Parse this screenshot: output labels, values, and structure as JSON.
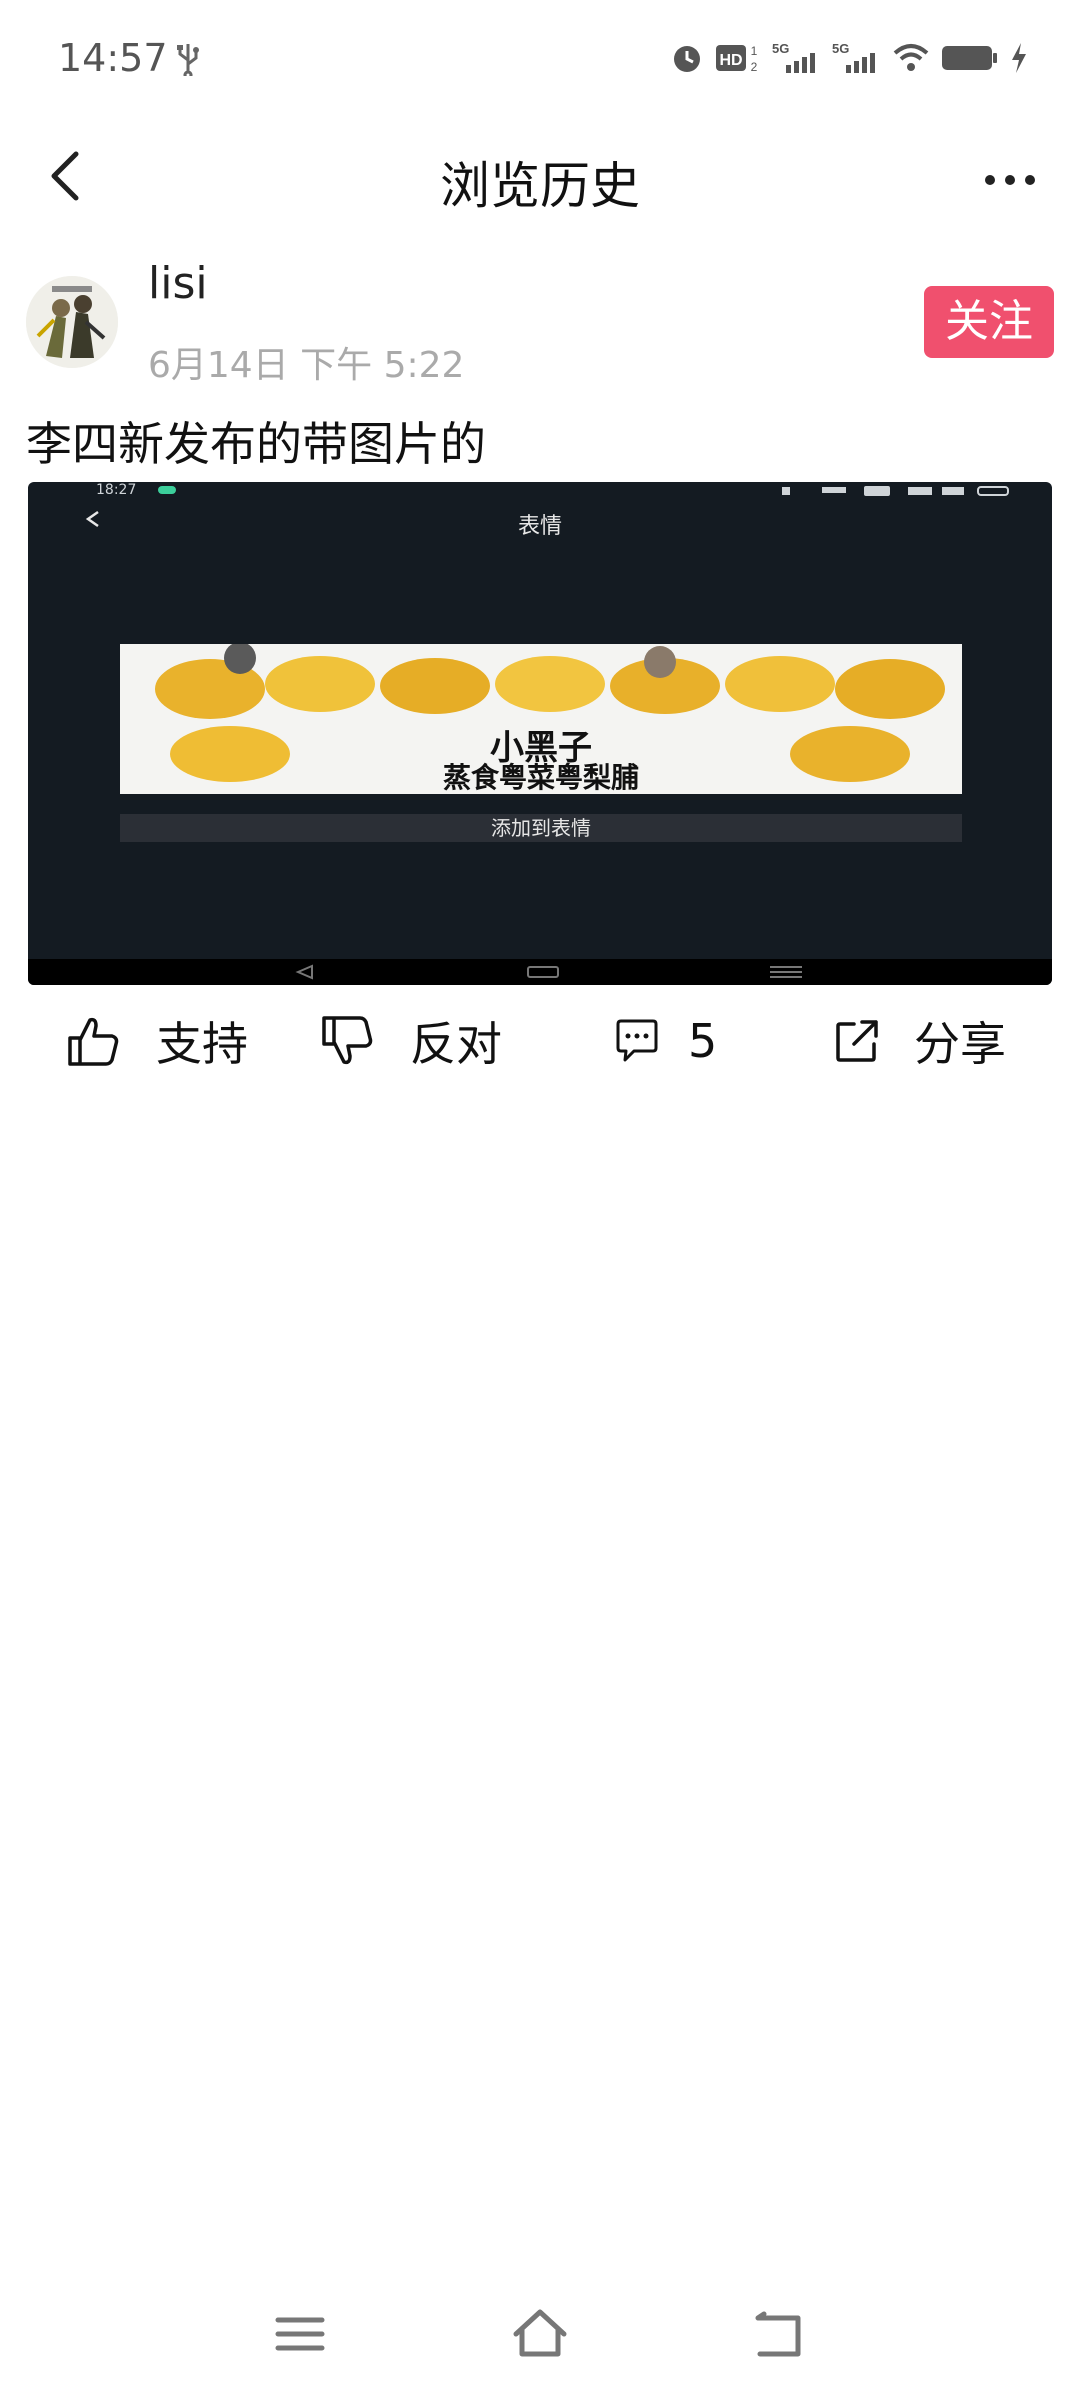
{
  "status_bar": {
    "time": "14:57",
    "icons": [
      "usb-icon",
      "alarm-icon",
      "hd-icon",
      "5g-signal-icon",
      "5g-signal-icon",
      "wifi-icon",
      "battery-icon",
      "charging-icon"
    ]
  },
  "header": {
    "title": "浏览历史"
  },
  "post": {
    "username": "lisi",
    "timestamp": "6月14日 下午 5:22",
    "follow_label": "关注",
    "text": "李四新发布的带图片的",
    "image": {
      "time": "18:27",
      "title": "表情",
      "meme_title": "小黑子",
      "meme_subtitle": "蒸食粤菜粤梨脯",
      "button_label": "添加到表情"
    }
  },
  "actions": {
    "support_label": "支持",
    "oppose_label": "反对",
    "comment_count": "5",
    "share_label": "分享"
  },
  "colors": {
    "accent": "#f0506e",
    "image_bg": "#141b22",
    "timestamp": "#aaaaaa"
  }
}
